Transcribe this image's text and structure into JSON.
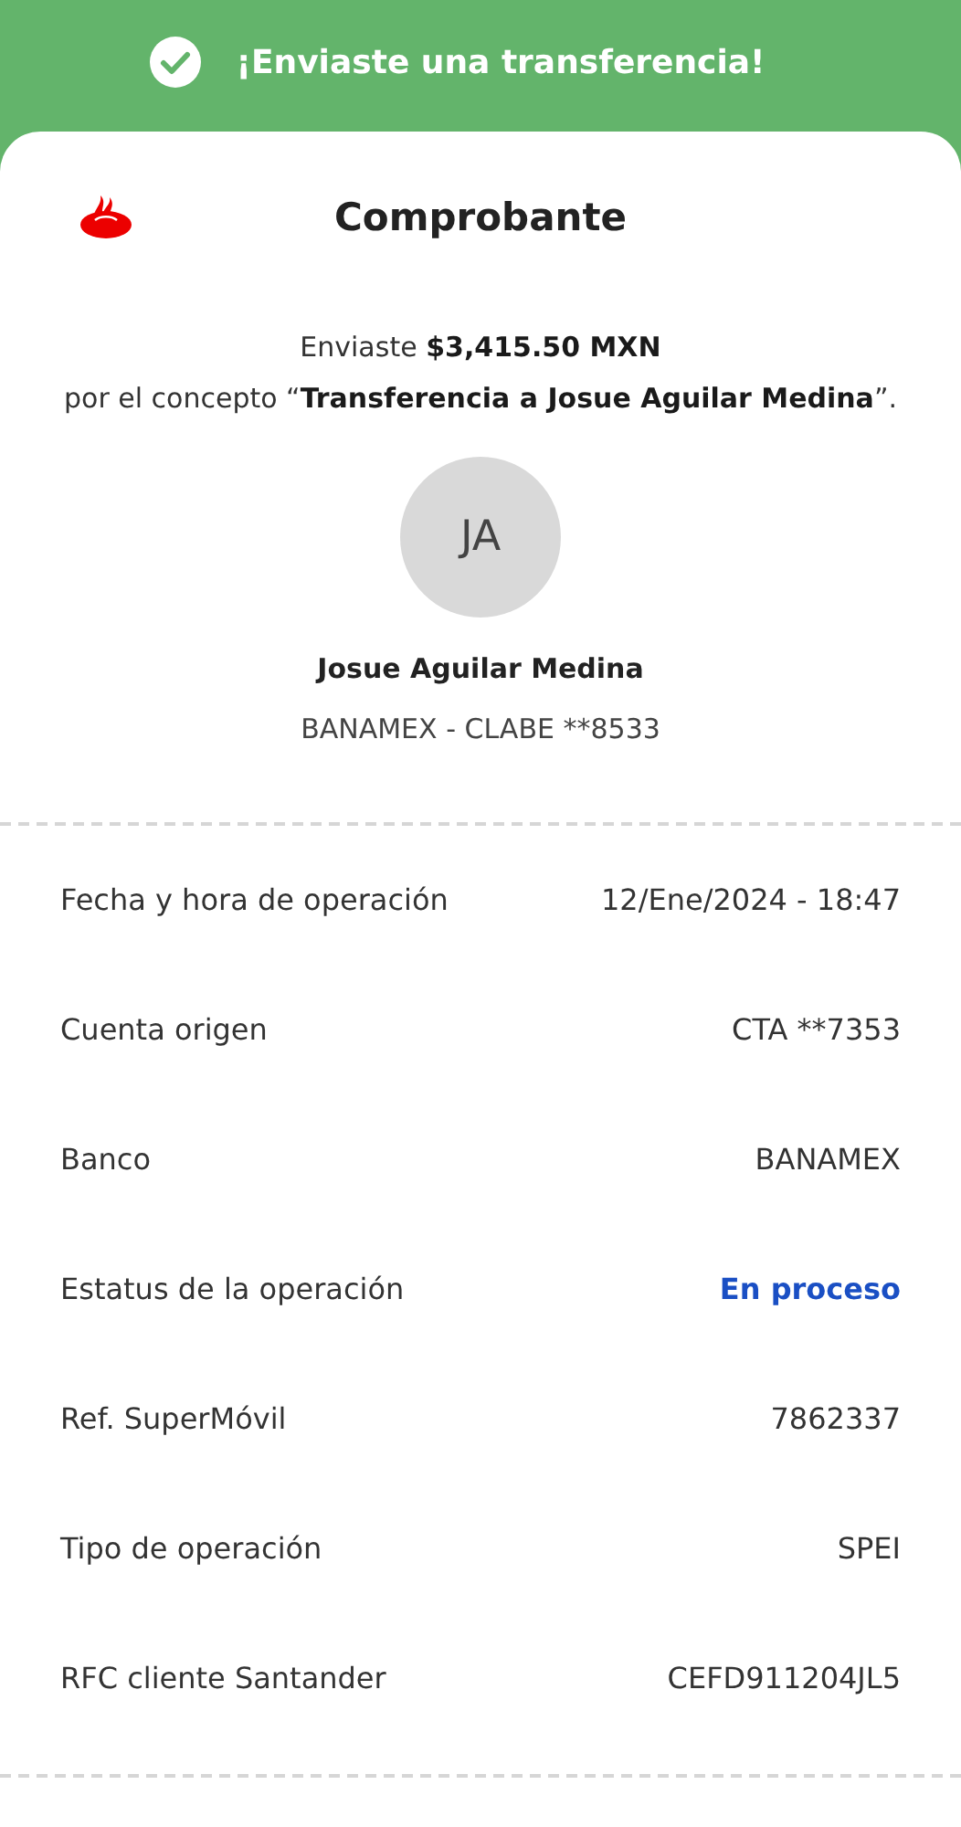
{
  "banner": {
    "title": "¡Enviaste una transferencia!"
  },
  "receipt": {
    "title": "Comprobante",
    "summary": [
      "Enviaste **$3,415.50 MXN**",
      "por el concepto “**Transferencia a Josue Aguilar Medina**”."
    ],
    "recipient": {
      "initials": "JA",
      "name": "Josue Aguilar Medina",
      "account": "BANAMEX - CLABE **8533"
    }
  },
  "details": [
    {
      "label": "Fecha y hora de operación",
      "value": "12/Ene/2024 - 18:47",
      "kind": "text"
    },
    {
      "label": "Cuenta origen",
      "value": "CTA **7353",
      "kind": "text"
    },
    {
      "label": "Banco",
      "value": "BANAMEX",
      "kind": "text"
    },
    {
      "label": "Estatus de la operación",
      "value": "En proceso",
      "kind": "status"
    },
    {
      "label": "Ref. SuperMóvil",
      "value": "7862337",
      "kind": "text"
    },
    {
      "label": "Tipo de operación",
      "value": "SPEI",
      "kind": "text"
    },
    {
      "label": "RFC cliente Santander",
      "value": "CEFD911204JL5",
      "kind": "text"
    }
  ]
}
